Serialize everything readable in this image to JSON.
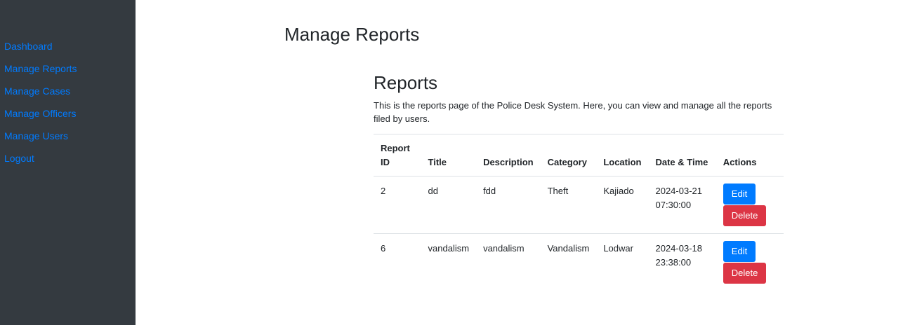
{
  "sidebar": {
    "items": [
      {
        "label": "Dashboard"
      },
      {
        "label": "Manage Reports"
      },
      {
        "label": "Manage Cases"
      },
      {
        "label": "Manage Officers"
      },
      {
        "label": "Manage Users"
      },
      {
        "label": "Logout"
      }
    ]
  },
  "header": {
    "title": "Manage Reports"
  },
  "main": {
    "title": "Reports",
    "description": "This is the reports page of the Police Desk System. Here, you can view and manage all the reports filed by users.",
    "table": {
      "headers": [
        "Report ID",
        "Title",
        "Description",
        "Category",
        "Location",
        "Date & Time",
        "Actions"
      ],
      "rows": [
        {
          "id": "2",
          "title": "dd",
          "description": "fdd",
          "category": "Theft",
          "location": "Kajiado",
          "datetime": "2024-03-21 07:30:00",
          "edit_label": "Edit",
          "delete_label": "Delete"
        },
        {
          "id": "6",
          "title": "vandalism",
          "description": "vandalism",
          "category": "Vandalism",
          "location": "Lodwar",
          "datetime": "2024-03-18 23:38:00",
          "edit_label": "Edit",
          "delete_label": "Delete"
        }
      ]
    }
  },
  "colors": {
    "sidebar_bg": "#343a40",
    "link": "#007bff",
    "edit_button": "#007bff",
    "delete_button": "#dc3545"
  }
}
